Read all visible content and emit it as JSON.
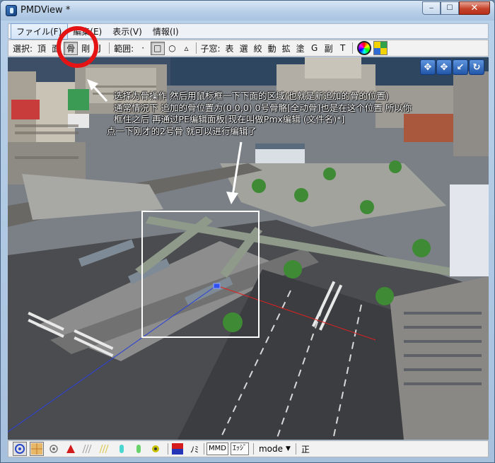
{
  "window": {
    "title": "PMDView *",
    "controls": {
      "minimize": "‒",
      "maximize": "☐",
      "close": "✕"
    }
  },
  "menu": {
    "items": [
      {
        "label": "ファイル(F)",
        "active": true
      },
      {
        "label": "編集(E)",
        "active": false
      },
      {
        "label": "表示(V)",
        "active": false
      },
      {
        "label": "情報(I)",
        "active": false
      }
    ]
  },
  "toolbar": {
    "select_label": "選択:",
    "select_items": [
      {
        "label": "頂",
        "pressed": false
      },
      {
        "label": "面",
        "pressed": false
      },
      {
        "label": "骨",
        "pressed": true
      },
      {
        "label": "剛",
        "pressed": false
      },
      {
        "label": "J",
        "pressed": false
      }
    ],
    "range_label": "範囲:",
    "range_items": [
      {
        "label": "·",
        "pressed": false
      },
      {
        "label": "□",
        "pressed": true
      },
      {
        "label": "○",
        "pressed": false
      },
      {
        "label": "▵",
        "pressed": false
      }
    ],
    "subwindow_label": "子窓:",
    "subwindow_items": [
      "表",
      "選",
      "絞",
      "動",
      "拡",
      "塗",
      "G",
      "副",
      "T"
    ],
    "icons": [
      "color-wheel-icon",
      "color-palette-icon"
    ]
  },
  "viewport": {
    "nav_tools": [
      "✥",
      "✥",
      "↙",
      "↻"
    ],
    "annotation_lines": [
      "选择为骨操作 然后用鼠标框一下下面的区域(也就是新追加的骨的位置)",
      "通常情况下 追加的骨位置为(0,0,0) 0号骨骼[全动骨]也是在这个位置 所以你",
      "框住之后 再通过PE编辑面板[现在叫做Pmx编辑 (文件名)*]",
      "点一下刚才的2号骨 就可以进行编辑了"
    ],
    "colors": {
      "annotation_arrow": "#ffffff",
      "selection_box": "#ffffff",
      "highlight_circle": "#e51414"
    }
  },
  "statusbar": {
    "toggle_labels": [
      "ﾉﾐ"
    ],
    "boxed_labels": [
      "MMD",
      "ｴｯｼﾞ"
    ],
    "mode_label": "mode",
    "mode_arrow": "▼",
    "right_label": "正"
  }
}
